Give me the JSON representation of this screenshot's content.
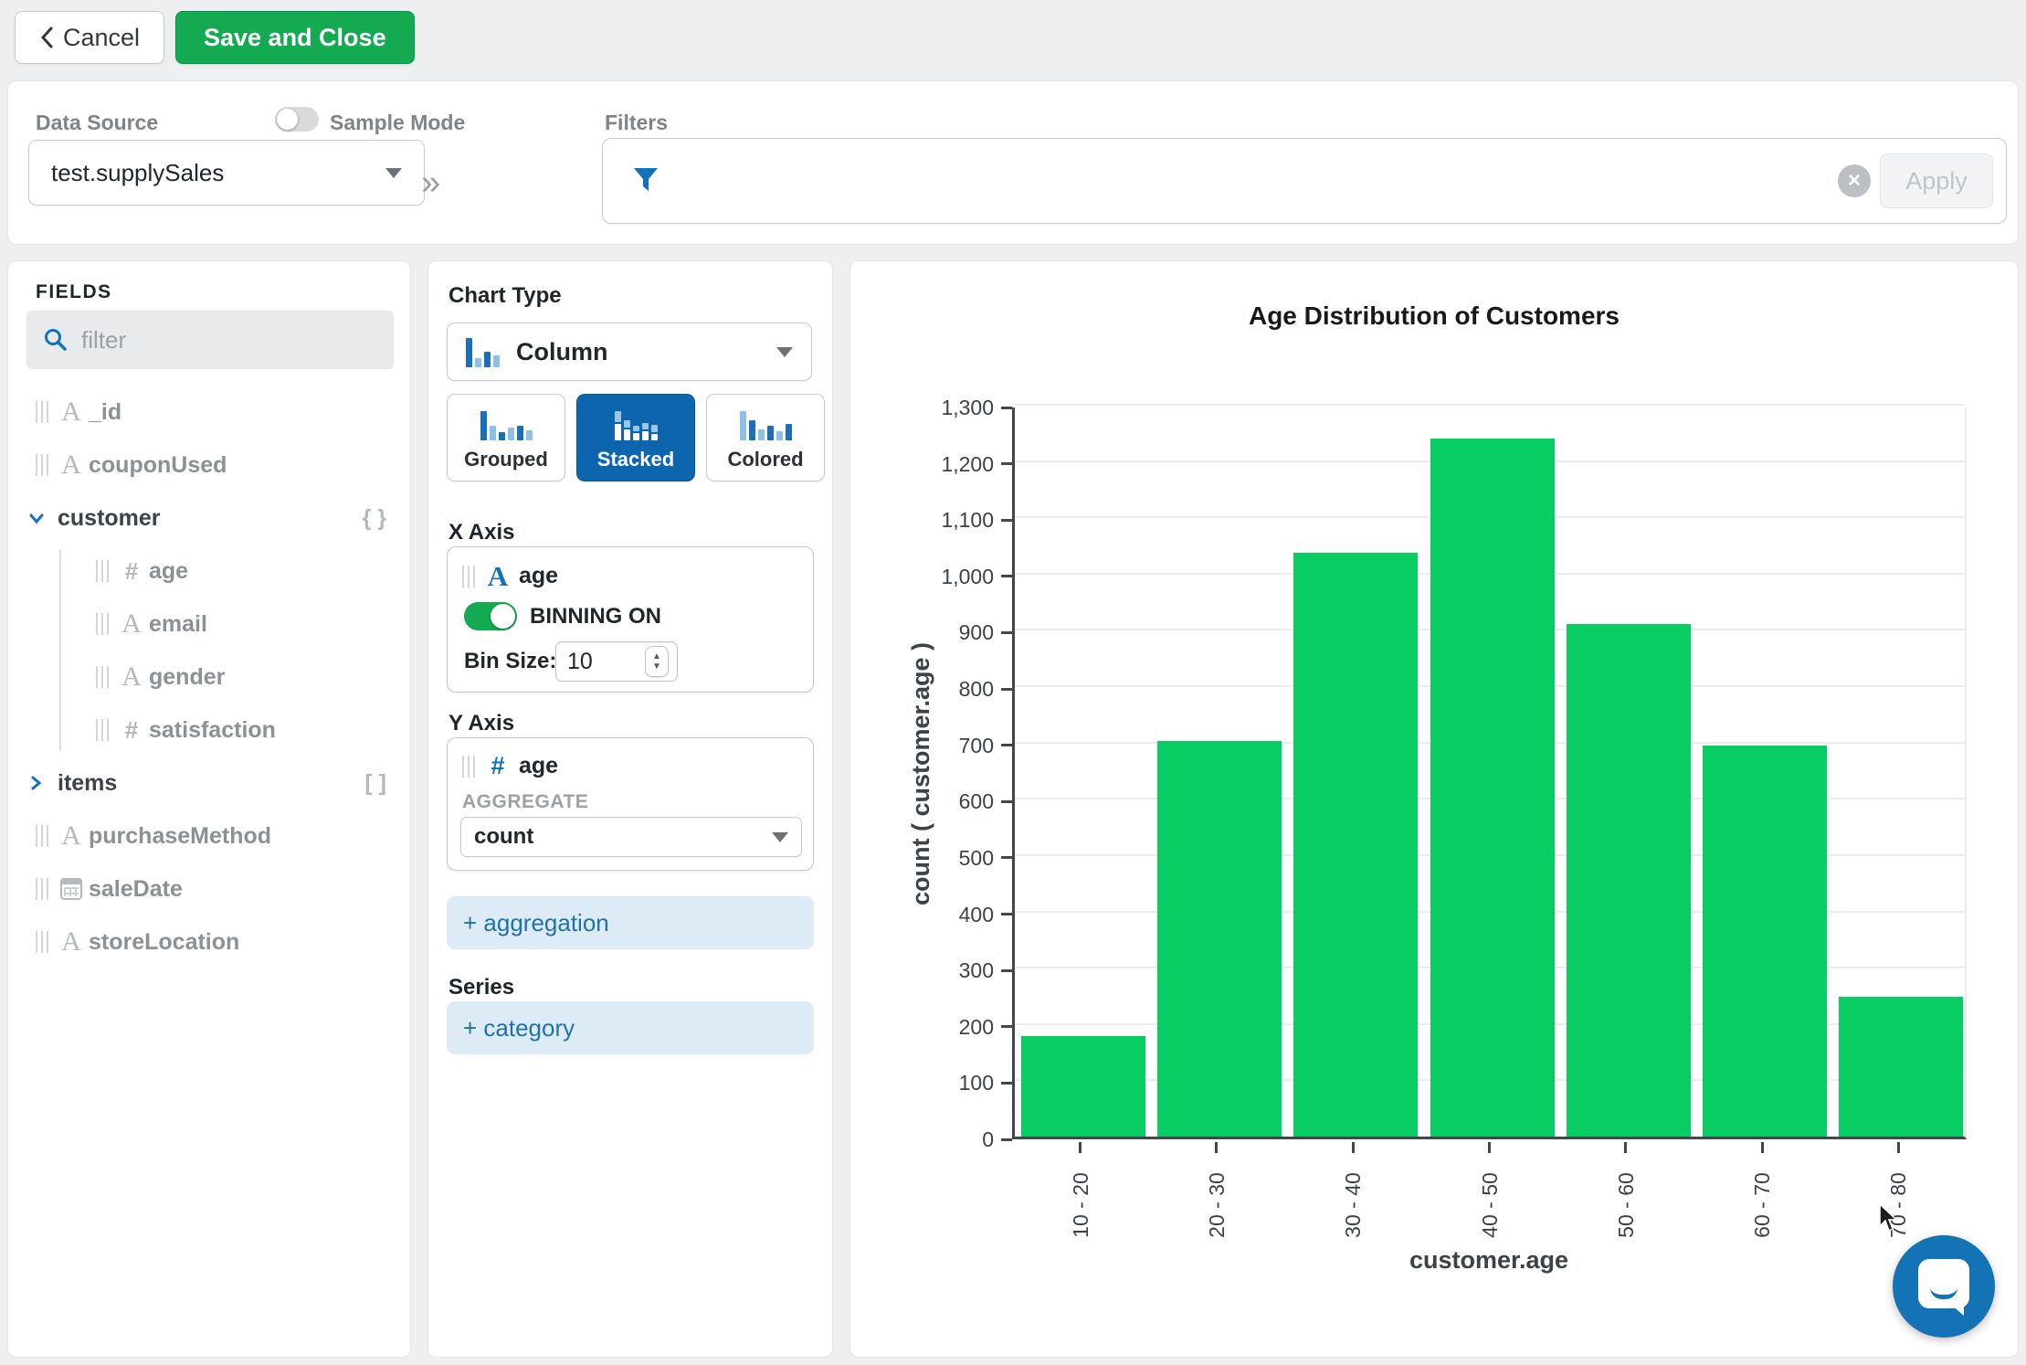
{
  "toolbar": {
    "cancel_label": "Cancel",
    "save_label": "Save and Close"
  },
  "header": {
    "datasource_label": "Data Source",
    "datasource_value": "test.supplySales",
    "sample_mode_label": "Sample Mode",
    "filters_label": "Filters",
    "apply_label": "Apply",
    "clear_glyph": "×",
    "chevrons_glyph": "»"
  },
  "fields_panel": {
    "title": "FIELDS",
    "filter_placeholder": "filter",
    "fields": [
      {
        "name": "_id",
        "type": "string",
        "indent": 0
      },
      {
        "name": "couponUsed",
        "type": "string",
        "indent": 0
      },
      {
        "name": "customer",
        "type": "object",
        "indent": 0,
        "expanded": true,
        "badge": "{ }"
      },
      {
        "name": "age",
        "type": "number",
        "indent": 1
      },
      {
        "name": "email",
        "type": "string",
        "indent": 1
      },
      {
        "name": "gender",
        "type": "string",
        "indent": 1
      },
      {
        "name": "satisfaction",
        "type": "number",
        "indent": 1
      },
      {
        "name": "items",
        "type": "array",
        "indent": 0,
        "expanded": false,
        "badge": "[ ]"
      },
      {
        "name": "purchaseMethod",
        "type": "string",
        "indent": 0
      },
      {
        "name": "saleDate",
        "type": "date",
        "indent": 0
      },
      {
        "name": "storeLocation",
        "type": "string",
        "indent": 0
      }
    ]
  },
  "config": {
    "chart_type_label": "Chart Type",
    "chart_type_value": "Column",
    "modes": [
      {
        "label": "Grouped",
        "selected": false
      },
      {
        "label": "Stacked",
        "selected": true
      },
      {
        "label": "Colored",
        "selected": false
      }
    ],
    "x_axis": {
      "label": "X Axis",
      "field": "age",
      "binning_label": "BINNING ON",
      "binning_on": true,
      "bin_size_label": "Bin Size:",
      "bin_size_value": "10"
    },
    "y_axis": {
      "label": "Y Axis",
      "field": "age",
      "aggregate_label": "AGGREGATE",
      "aggregate_value": "count"
    },
    "add_aggregation_label": "+ aggregation",
    "series_label": "Series",
    "add_category_label": "+ category"
  },
  "chart_data": {
    "type": "bar",
    "title": "Age Distribution of Customers",
    "categories": [
      "10 - 20",
      "20 - 30",
      "30 - 40",
      "40 - 50",
      "50 - 60",
      "60 - 70",
      "70 - 80"
    ],
    "values": [
      178,
      703,
      1037,
      1240,
      910,
      695,
      248
    ],
    "xlabel": "customer.age",
    "ylabel": "count ( customer.age )",
    "ylim": [
      0,
      1300
    ],
    "y_tick_interval": 100,
    "grid": true,
    "legend": false,
    "bar_color": "#08cd63"
  },
  "colors": {
    "accent_blue": "#1173bc",
    "selected_blue": "#0d65ae",
    "brand_green": "#13aa52",
    "bar_green": "#08cd63",
    "icon_bar_dark": "#1b6fb5",
    "icon_bar_light": "#8fc0e4"
  }
}
